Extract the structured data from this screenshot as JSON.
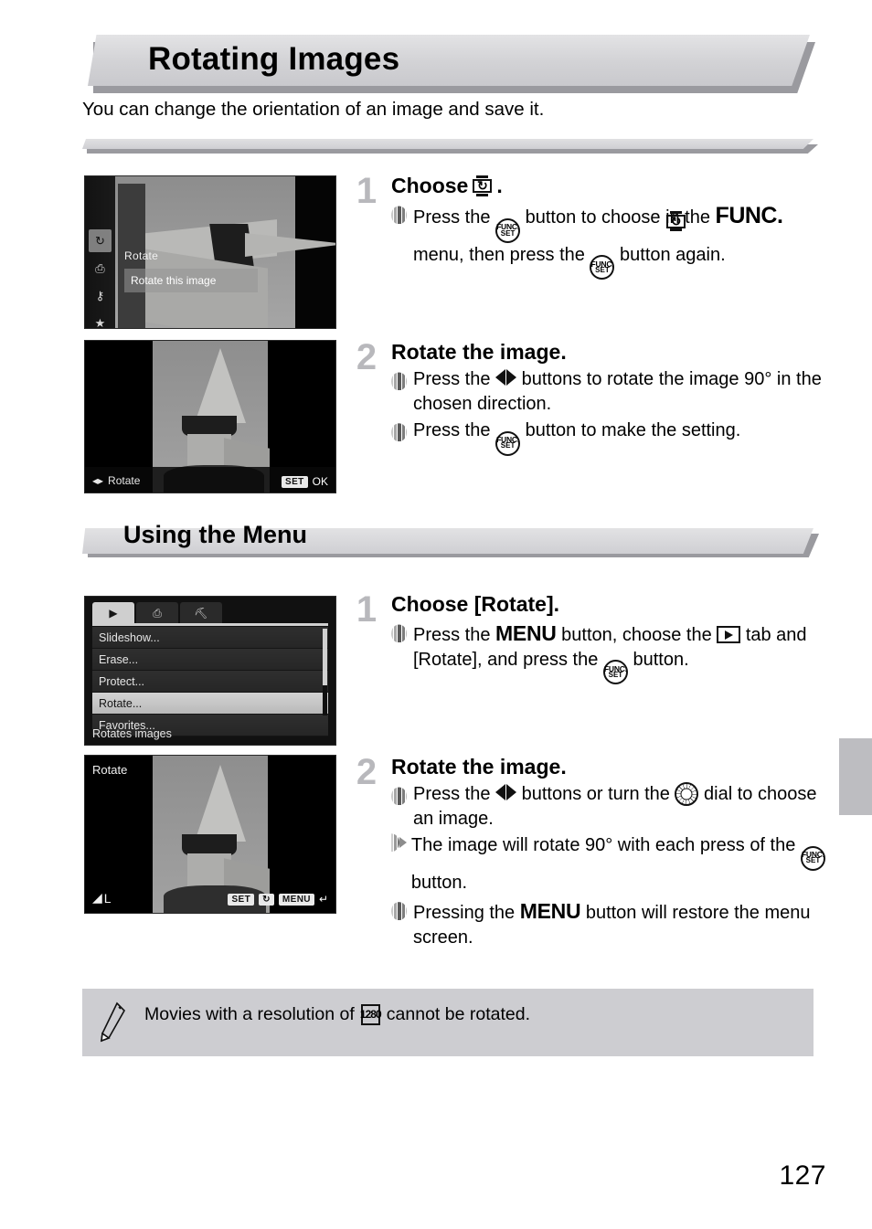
{
  "page": {
    "title": "Rotating Images",
    "intro": "You can change the orientation of an image and save it.",
    "number": "127",
    "section_heading": "Using the Menu"
  },
  "icons": {
    "rotate": "rotate-icon",
    "rotate_glyph": "↻",
    "func_set_top": "FUNC.",
    "func_set_bottom": "SET",
    "func_word": "FUNC.",
    "menu_word": "MENU",
    "play_tab": "playback-tab-icon",
    "dial": "control-dial-icon",
    "movie_res": "1280",
    "bullet": "bullet-marker-icon"
  },
  "steps": {
    "func_method": [
      {
        "number": "1",
        "title_pre": "Choose",
        "title_post": ".",
        "lines": [
          {
            "marker": "bars",
            "parts": [
              {
                "t": "text",
                "v": "Press the "
              },
              {
                "t": "funcset"
              },
              {
                "t": "text",
                "v": " button to choose "
              },
              {
                "t": "rotate"
              },
              {
                "t": "text",
                "v": " in the "
              },
              {
                "t": "funcword"
              },
              {
                "t": "text",
                "v": " menu, then press the "
              },
              {
                "t": "funcset"
              },
              {
                "t": "text",
                "v": " button again."
              }
            ]
          }
        ]
      },
      {
        "number": "2",
        "title_pre": "Rotate the image.",
        "title_post": "",
        "lines": [
          {
            "marker": "bars",
            "parts": [
              {
                "t": "text",
                "v": "Press the "
              },
              {
                "t": "leftright"
              },
              {
                "t": "text",
                "v": " buttons to rotate the image 90° in the chosen direction."
              }
            ]
          },
          {
            "marker": "bars",
            "parts": [
              {
                "t": "text",
                "v": "Press the "
              },
              {
                "t": "funcset"
              },
              {
                "t": "text",
                "v": " button to make the setting."
              }
            ]
          }
        ]
      }
    ],
    "menu_method": [
      {
        "number": "1",
        "title_pre": "Choose [Rotate].",
        "title_post": "",
        "lines": [
          {
            "marker": "bars",
            "parts": [
              {
                "t": "text",
                "v": "Press the "
              },
              {
                "t": "menuword"
              },
              {
                "t": "text",
                "v": " button, choose the "
              },
              {
                "t": "play"
              },
              {
                "t": "text",
                "v": " tab and [Rotate], and press the "
              },
              {
                "t": "funcset"
              },
              {
                "t": "text",
                "v": " button."
              }
            ]
          }
        ]
      },
      {
        "number": "2",
        "title_pre": "Rotate the image.",
        "title_post": "",
        "lines": [
          {
            "marker": "bars",
            "parts": [
              {
                "t": "text",
                "v": "Press the "
              },
              {
                "t": "leftright"
              },
              {
                "t": "text",
                "v": " buttons or turn the "
              },
              {
                "t": "dial"
              },
              {
                "t": "text",
                "v": " dial to choose an image."
              }
            ]
          },
          {
            "marker": "arrow",
            "parts": [
              {
                "t": "text",
                "v": "The image will rotate 90° with each press of the "
              },
              {
                "t": "funcset"
              },
              {
                "t": "text",
                "v": " button."
              }
            ]
          },
          {
            "marker": "bars",
            "parts": [
              {
                "t": "text",
                "v": "Pressing the "
              },
              {
                "t": "menuword"
              },
              {
                "t": "text",
                "v": " button will restore the menu screen."
              }
            ]
          }
        ]
      }
    ]
  },
  "screens": {
    "func_menu": {
      "side_icons": [
        "rotate-icon",
        "print-icon",
        "protect-key-icon",
        "favorites-star-icon"
      ],
      "selected_icon_index": 0,
      "header_label": "Rotate",
      "selected_row": "Rotate this image"
    },
    "rotate_preview": {
      "hint_left": "Rotate",
      "hint_left_icon": "left-right-arrows-icon",
      "key": "SET",
      "key_action": "OK"
    },
    "playback_menu": {
      "tabs": [
        "playback-tab-icon",
        "print-tab-icon",
        "settings-tab-icon"
      ],
      "active_tab_index": 0,
      "items": [
        "Slideshow...",
        "Erase...",
        "Protect...",
        "Rotate...",
        "Favorites..."
      ],
      "selected_index": 3,
      "hint": "Rotates images"
    },
    "rotate_menu_preview": {
      "title": "Rotate",
      "quality": "L",
      "key_set": "SET",
      "key_set_icon": "rotate-icon",
      "key_menu": "MENU",
      "key_menu_icon": "return-arrow-icon"
    }
  },
  "note": {
    "icon": "pencil-icon",
    "text_before": "Movies with a resolution of",
    "badge": "1280",
    "text_after": "cannot be rotated."
  }
}
